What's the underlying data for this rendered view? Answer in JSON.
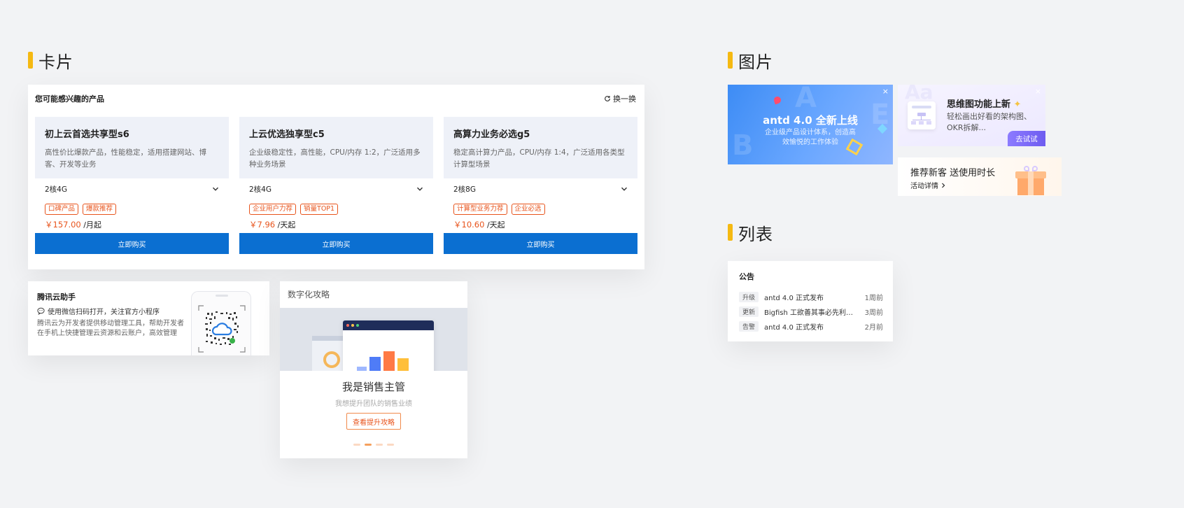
{
  "sections": {
    "cards": "卡片",
    "images": "图片",
    "list": "列表"
  },
  "products": {
    "header": "您可能感兴趣的产品",
    "refresh": "换一换",
    "buy_label": "立即购买",
    "items": [
      {
        "title": "初上云首选共享型s6",
        "desc": "高性价比爆款产品，性能稳定，适用搭建网站、博客、开发等业务",
        "spec": "2核4G",
        "tags": [
          "口碑产品",
          "爆款推荐"
        ],
        "price": "￥157.00",
        "unit": "/月起"
      },
      {
        "title": "上云优选独享型c5",
        "desc": "企业级稳定性，高性能，CPU/内存 1:2，广泛适用多种业务场景",
        "spec": "2核4G",
        "tags": [
          "企业用户力荐",
          "销量TOP1"
        ],
        "price": "￥7.96",
        "unit": "/天起"
      },
      {
        "title": "高算力业务必选g5",
        "desc": "稳定高计算力产品，CPU/内存 1:4，广泛适用各类型计算型场景",
        "spec": "2核8G",
        "tags": [
          "计算型业务力荐",
          "企业必选"
        ],
        "price": "￥10.60",
        "unit": "/天起"
      }
    ]
  },
  "assistant": {
    "title": "腾讯云助手",
    "line": "使用微信扫码打开，关注官方小程序",
    "desc": "腾讯云为开发者提供移动管理工具，帮助开发者在手机上快捷管理云资源和云账户，高效管理"
  },
  "digital": {
    "title": "数字化攻略",
    "heading": "我是销售主管",
    "sub": "我想提升团队的销售业绩",
    "button": "查看提升攻略"
  },
  "banners": {
    "antd": {
      "title": "antd 4.0 全新上线",
      "sub": "企业级产品设计体系，创造高效愉悦的工作体验",
      "close": "×"
    },
    "mindmap": {
      "title": "思维图功能上新",
      "sub": "轻松画出好看的架构图、OKR拆解...",
      "button": "去试试",
      "close": "×"
    },
    "referral": {
      "title": "推荐新客 送使用时长",
      "link": "活动详情"
    }
  },
  "notice": {
    "title": "公告",
    "rows": [
      {
        "badge": "升级",
        "text": "antd 4.0 正式发布",
        "time": "1周前"
      },
      {
        "badge": "更新",
        "text": "Bigfish 工欲善其事必先利其器，bigfish更新",
        "time": "3周前"
      },
      {
        "badge": "告警",
        "text": "antd 4.0 正式发布",
        "time": "2月前"
      }
    ]
  },
  "colors": {
    "accent": "#f5b912",
    "primary": "#0b6fd1",
    "price": "#e8541c"
  },
  "icons": {
    "refresh": "refresh-icon",
    "chevron": "chevron-down-icon",
    "wechat": "wechat-icon",
    "qr": "qr-code-icon"
  }
}
